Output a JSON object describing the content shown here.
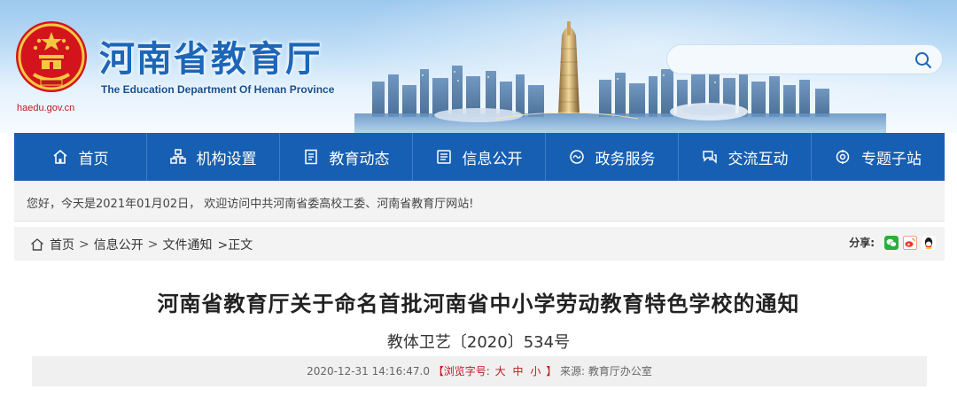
{
  "header": {
    "title": "河南省教育厅",
    "subtitle": "The Education Department Of Henan Province",
    "domain": "haedu.gov.cn",
    "emblem_icon": "national-emblem-icon",
    "brand_color": "#1d66b8",
    "search": {
      "value": "",
      "placeholder": "",
      "button_icon": "search-icon"
    }
  },
  "nav": {
    "background": "#175fb2",
    "items": [
      {
        "label": "首页",
        "icon": "home-icon"
      },
      {
        "label": "机构设置",
        "icon": "organization-icon"
      },
      {
        "label": "教育动态",
        "icon": "news-icon"
      },
      {
        "label": "信息公开",
        "icon": "info-icon"
      },
      {
        "label": "政务服务",
        "icon": "service-icon"
      },
      {
        "label": "交流互动",
        "icon": "interaction-icon"
      },
      {
        "label": "专题子站",
        "icon": "topic-icon"
      }
    ]
  },
  "welcome": {
    "text": "您好，今天是2021年01月02日， 欢迎访问中共河南省委高校工委、河南省教育厅网站!"
  },
  "breadcrumb": {
    "items": [
      "首页",
      "信息公开",
      "文件通知"
    ],
    "separator": ">",
    "current": ">正文"
  },
  "share": {
    "label": "分享:",
    "targets": [
      {
        "icon": "wechat-icon",
        "color": "#2aae3c"
      },
      {
        "icon": "weibo-icon",
        "color": "#e8382f"
      },
      {
        "icon": "qq-icon",
        "color": "#1a1a1a"
      }
    ]
  },
  "article": {
    "title": "河南省教育厅关于命名首批河南省中小学劳动教育特色学校的通知",
    "doc_number": "教体卫艺〔2020〕534号",
    "datetime": "2020-12-31 14:16:47.0",
    "fontsize_label": "【浏览字号:",
    "fontsize_options": [
      "大",
      "中",
      "小"
    ],
    "fontsize_close": "】",
    "source_label": "来源:",
    "source": "教育厅办公室"
  }
}
